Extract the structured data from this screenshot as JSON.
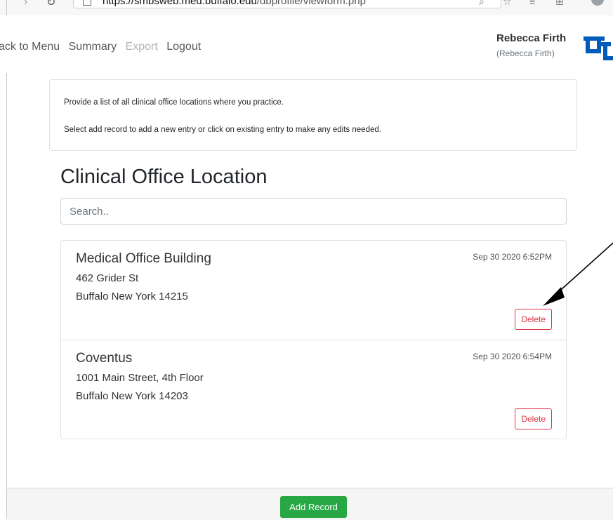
{
  "browser": {
    "url_host": "https://smbsweb.med.buffalo.edu",
    "url_path": "/dbprofile/viewform.php"
  },
  "nav": {
    "back_label": "ack to Menu",
    "summary_label": "Summary",
    "export_label": "Export",
    "logout_label": "Logout"
  },
  "user": {
    "name": "Rebecca Firth",
    "subtitle": "(Rebecca Firth)"
  },
  "instructions": {
    "line1": "Provide a list of all clinical office locations where you practice.",
    "line2": "Select add record to add a new entry or click on existing entry to make any edits needed."
  },
  "page": {
    "title": "Clinical Office Location"
  },
  "search": {
    "placeholder": "Search.."
  },
  "records": [
    {
      "name": "Medical Office Building",
      "street": "462 Grider St",
      "city_line": "Buffalo New York 14215",
      "timestamp": "Sep 30 2020 6:52PM",
      "delete_label": "Delete"
    },
    {
      "name": "Coventus",
      "street": "1001 Main Street, 4th Floor",
      "city_line": "Buffalo New York 14203",
      "timestamp": "Sep 30 2020 6:54PM",
      "delete_label": "Delete"
    }
  ],
  "footer": {
    "add_label": "Add Record"
  },
  "colors": {
    "delete": "#dc3545",
    "add": "#28a745",
    "logo": "#005bbb"
  },
  "icons": [
    "back-icon",
    "reload-icon",
    "page-icon",
    "star-icon",
    "favorites-icon",
    "collections-icon",
    "profile-avatar-icon",
    "ub-logo-icon",
    "annotation-arrow"
  ]
}
